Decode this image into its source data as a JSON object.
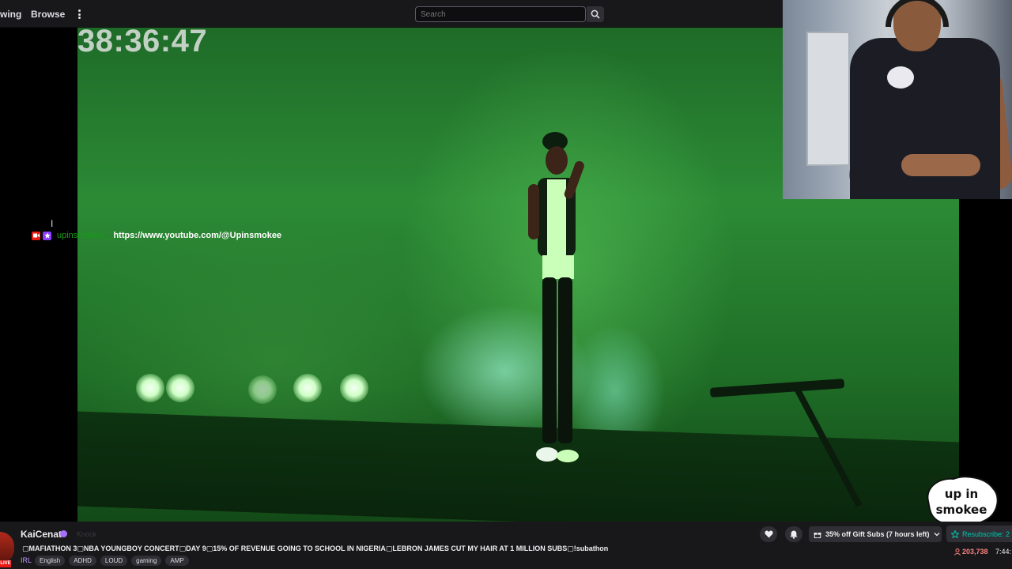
{
  "nav": {
    "following_label": "wing",
    "browse_label": "Browse",
    "search_placeholder": "Search"
  },
  "overlay": {
    "timer": "38:36:47"
  },
  "chat": {
    "username": "upinsmokee_",
    "message": "https://www.youtube.com/@Upinsmokee"
  },
  "stream": {
    "channel": "KaiCenat",
    "knock_label": "Knock",
    "title": "▢MAFIATHON 3▢NBA YOUNGBOY CONCERT▢DAY 9▢15% OF REVENUE GOING TO SCHOOL IN NIGERIA▢LEBRON JAMES CUT MY HAIR AT 1 MILLION SUBS▢!subathon",
    "category": "IRL",
    "tags": [
      "English",
      "ADHD",
      "LOUD",
      "gaming",
      "AMP"
    ],
    "live_badge": "LIVE",
    "viewers": "203,738",
    "uptime": "7:44:"
  },
  "actions": {
    "gift_subs_label": "35% off Gift Subs (7 hours left)",
    "resub_label": "Resubscribe: 2"
  },
  "colors": {
    "accent_purple": "#a970ff",
    "live_red": "#e91916",
    "chat_user_green": "#1a9b1a",
    "resub_teal": "#00c8af",
    "viewer_red": "#ff8280"
  }
}
